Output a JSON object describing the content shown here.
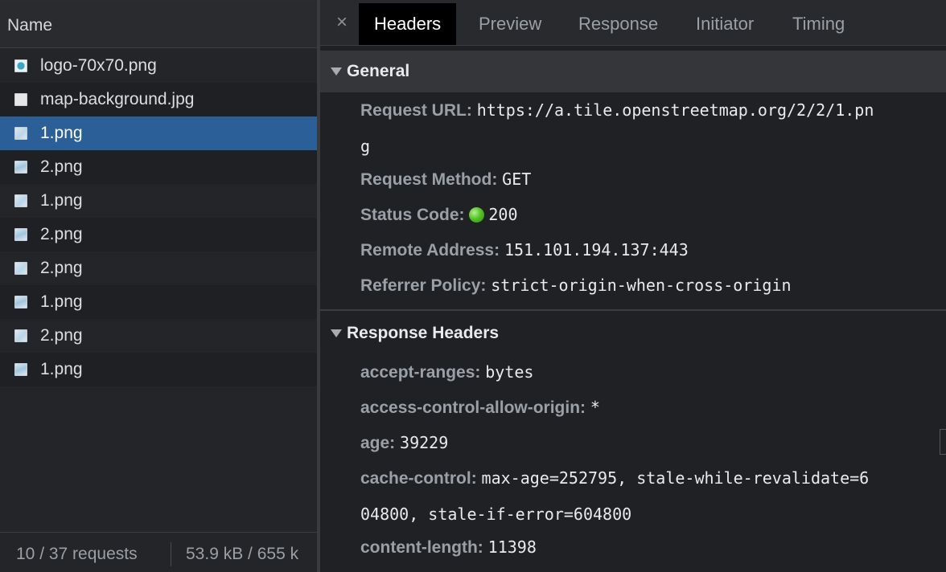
{
  "request_list": {
    "header": "Name",
    "rows": [
      {
        "name": "logo-70x70.png",
        "icon": "logo-icon"
      },
      {
        "name": "map-background.jpg",
        "icon": "image-file-icon"
      },
      {
        "name": "1.png",
        "icon": "image-file-icon",
        "selected": true
      },
      {
        "name": "2.png",
        "icon": "image-file-icon"
      },
      {
        "name": "1.png",
        "icon": "image-file-icon"
      },
      {
        "name": "2.png",
        "icon": "image-file-icon"
      },
      {
        "name": "2.png",
        "icon": "image-file-icon"
      },
      {
        "name": "1.png",
        "icon": "image-file-icon"
      },
      {
        "name": "2.png",
        "icon": "image-file-icon"
      },
      {
        "name": "1.png",
        "icon": "image-file-icon"
      }
    ],
    "footer": {
      "requests": "10 / 37 requests",
      "size": "53.9 kB / 655 k"
    }
  },
  "tabs": {
    "close": "×",
    "items": [
      "Headers",
      "Preview",
      "Response",
      "Initiator",
      "Timing"
    ],
    "active": "Headers"
  },
  "general": {
    "title": "General",
    "request_url_label": "Request URL:",
    "request_url_line1": "https://a.tile.openstreetmap.org/2/2/1.pn",
    "request_url_line2": "g",
    "method_label": "Request Method:",
    "method_value": "GET",
    "status_label": "Status Code:",
    "status_value": "200",
    "remote_label": "Remote Address:",
    "remote_value": "151.101.194.137:443",
    "referrer_label": "Referrer Policy:",
    "referrer_value": "strict-origin-when-cross-origin"
  },
  "response_headers": {
    "title": "Response Headers",
    "accept_ranges_label": "accept-ranges:",
    "accept_ranges_value": "bytes",
    "acao_label": "access-control-allow-origin:",
    "acao_value": "*",
    "age_label": "age:",
    "age_value": "39229",
    "cache_control_label": "cache-control:",
    "cache_control_line1": "max-age=252795, stale-while-revalidate=6",
    "cache_control_line2": "04800, stale-if-error=604800",
    "content_length_label": "content-length:",
    "content_length_value": "11398"
  },
  "colors": {
    "selected_row": "#2a6097",
    "active_tab_bg": "#000000",
    "status_ok": "#54c429"
  }
}
